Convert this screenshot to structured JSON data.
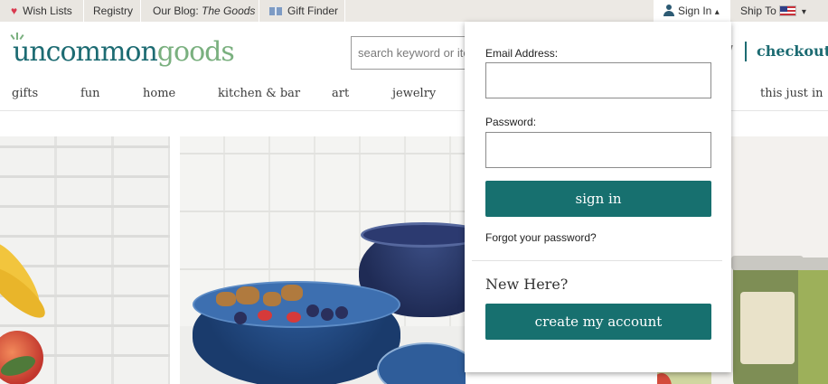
{
  "topbar": {
    "wish_lists": "Wish Lists",
    "registry": "Registry",
    "blog_prefix": "Our Blog:",
    "blog_name": "The Goods",
    "gift_finder": "Gift Finder",
    "sign_in": "Sign In",
    "sign_in_caret": "▴",
    "ship_to": "Ship To",
    "ship_caret": "▾"
  },
  "header": {
    "logo_part1": "uncommon",
    "logo_part2": "goods",
    "search_placeholder": "search keyword or item #",
    "cart_glyph": "/",
    "checkout": "checkout"
  },
  "nav": {
    "items": [
      "gifts",
      "fun",
      "home",
      "kitchen & bar",
      "art",
      "jewelry",
      "this just in"
    ]
  },
  "signin_panel": {
    "email_label": "Email Address:",
    "password_label": "Password:",
    "sign_in_button": "sign in",
    "forgot_link": "Forgot your password?",
    "new_here": "New Here?",
    "create_account_button": "create my account"
  },
  "colors": {
    "brand_teal": "#1c6b72",
    "brand_green": "#7ab07f",
    "button_teal": "#17706f",
    "heart_red": "#d9394f",
    "topbar_bg": "#ece9e4"
  },
  "icons": {
    "heart": "heart-icon",
    "gift": "gift-icon",
    "user": "user-icon",
    "flag": "us-flag-icon"
  }
}
